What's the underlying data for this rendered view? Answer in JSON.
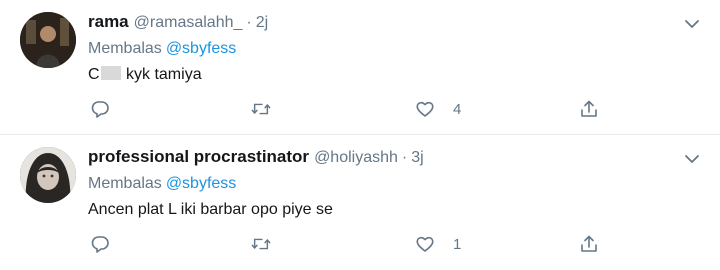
{
  "tweets": [
    {
      "display_name": "rama",
      "handle": "@ramasalahh_",
      "separator": "·",
      "time": "2j",
      "replying_label": "Membalas",
      "replying_mention": "@sbyfess",
      "text_before": "C",
      "text_after": "kyk tamiya",
      "text_censored": true,
      "likes": "4",
      "icons": [
        "reply-icon",
        "retweet-icon",
        "heart-icon",
        "share-icon",
        "chevron-down-icon"
      ]
    },
    {
      "display_name": "professional procrastinator",
      "handle": "@holiyashh",
      "separator": "·",
      "time": "3j",
      "replying_label": "Membalas",
      "replying_mention": "@sbyfess",
      "text": "Ancen plat L iki barbar opo piye se",
      "likes": "1",
      "icons": [
        "reply-icon",
        "retweet-icon",
        "heart-icon",
        "share-icon",
        "chevron-down-icon"
      ]
    }
  ],
  "colors": {
    "link": "#1b95e0",
    "secondary_text": "#657786",
    "primary_text": "#14171a",
    "divider": "#e6ecf0"
  }
}
